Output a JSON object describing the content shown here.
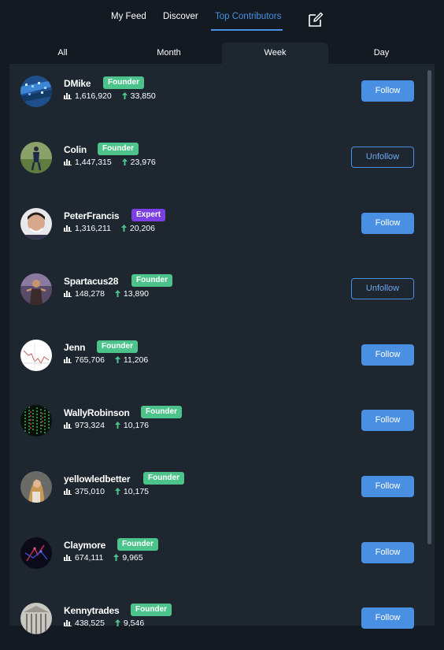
{
  "nav": {
    "items": [
      {
        "label": "My Feed",
        "active": false
      },
      {
        "label": "Discover",
        "active": false
      },
      {
        "label": "Top Contributors",
        "active": true
      }
    ],
    "compose_icon": "compose-edit-icon"
  },
  "tabs": [
    {
      "label": "All",
      "active": false
    },
    {
      "label": "Month",
      "active": false
    },
    {
      "label": "Week",
      "active": true
    },
    {
      "label": "Day",
      "active": false
    }
  ],
  "colors": {
    "accent": "#4a90e2",
    "founder": "#4cc38a",
    "expert": "#7b3fe4",
    "background": "#141a21",
    "panel": "#1e2630"
  },
  "contributors": [
    {
      "name": "DMike",
      "badge": "Founder",
      "views": "1,616,920",
      "score": "33,850",
      "action": "Follow"
    },
    {
      "name": "Colin",
      "badge": "Founder",
      "views": "1,447,315",
      "score": "23,976",
      "action": "Unfollow"
    },
    {
      "name": "PeterFrancis",
      "badge": "Expert",
      "views": "1,316,211",
      "score": "20,206",
      "action": "Follow"
    },
    {
      "name": "Spartacus28",
      "badge": "Founder",
      "views": "148,278",
      "score": "13,890",
      "action": "Unfollow"
    },
    {
      "name": "Jenn",
      "badge": "Founder",
      "views": "765,706",
      "score": "11,206",
      "action": "Follow"
    },
    {
      "name": "WallyRobinson",
      "badge": "Founder",
      "views": "973,324",
      "score": "10,176",
      "action": "Follow"
    },
    {
      "name": "yellowledbetter",
      "badge": "Founder",
      "views": "375,010",
      "score": "10,175",
      "action": "Follow"
    },
    {
      "name": "Claymore",
      "badge": "Founder",
      "views": "674,111",
      "score": "9,965",
      "action": "Follow"
    },
    {
      "name": "Kennytrades",
      "badge": "Founder",
      "views": "438,525",
      "score": "9,546",
      "action": "Follow"
    }
  ]
}
